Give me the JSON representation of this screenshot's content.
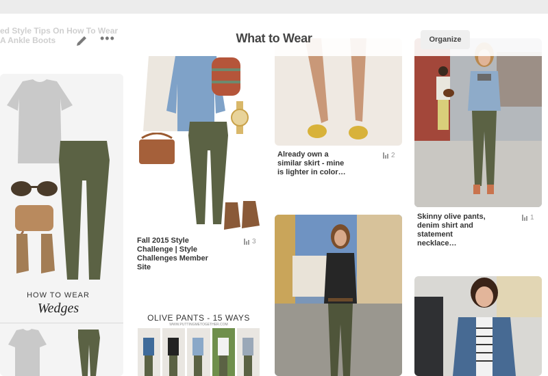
{
  "header": {
    "faded_title": "ed Style Tips On How To Wear A Ankle Boots",
    "title": "What to Wear",
    "organize_label": "Organize",
    "more_label": "•••"
  },
  "pins": [
    {
      "id": "wedges",
      "banner_small": "HOW TO WEAR",
      "banner_large": "Wedges"
    },
    {
      "id": "fall2015",
      "caption": "Fall 2015 Style Challenge | Style Challenges Member Site",
      "count": "3"
    },
    {
      "id": "olive15",
      "banner": "OLIVE PANTS - 15 WAYS",
      "banner_sub": "WWW.PUTTINGMETOGETHER.COM"
    },
    {
      "id": "skirt",
      "caption": "Already own a similar skirt - mine is lighter in color…",
      "count": "2"
    },
    {
      "id": "streetstyle"
    },
    {
      "id": "skinnyolive",
      "caption": "Skinny olive pants, denim shirt and statement necklace…",
      "count": "1"
    },
    {
      "id": "denimjacket"
    }
  ],
  "colors": {
    "olive": "#5b6244",
    "denim": "#7fa2c8",
    "tan": "#b98a5e",
    "grey_tee": "#c9c9c9",
    "accent": "#444444"
  },
  "icons": [
    "edit-icon",
    "more-icon",
    "stats-icon"
  ]
}
